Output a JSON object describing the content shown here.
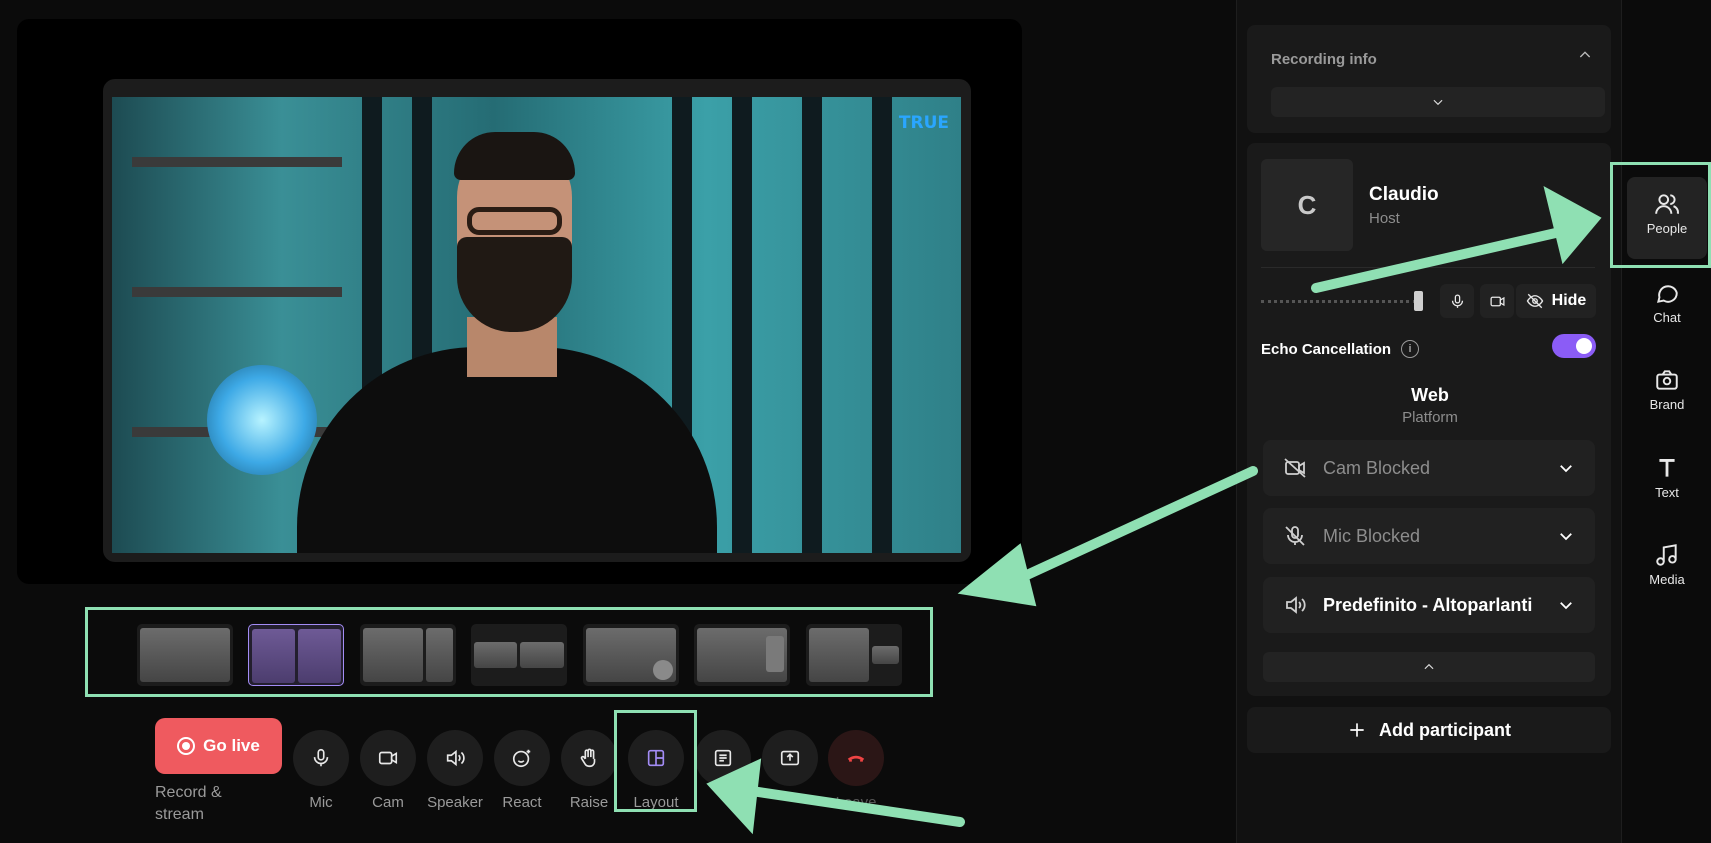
{
  "controls": {
    "go_live": "Go live",
    "go_live_sub": "Record & stream",
    "mic": "Mic",
    "cam": "Cam",
    "speaker": "Speaker",
    "react": "React",
    "raise": "Raise",
    "layout": "Layout",
    "leave": "Leave"
  },
  "video": {
    "overlay_tag": "TRUE"
  },
  "panel": {
    "recording_info": "Recording info",
    "participant": {
      "initial": "C",
      "name": "Claudio",
      "role": "Host"
    },
    "hide": "Hide",
    "echo_cancellation": "Echo Cancellation",
    "platform": "Web",
    "platform_label": "Platform",
    "devices": {
      "cam": "Cam Blocked",
      "mic": "Mic Blocked",
      "speaker": "Predefinito - Altoparlanti"
    },
    "add_participant": "Add participant"
  },
  "rail": {
    "people": "People",
    "chat": "Chat",
    "brand": "Brand",
    "text": "Text",
    "media": "Media"
  },
  "colors": {
    "accent_purple": "#8b5cf6",
    "go_live_red": "#ef5a5f",
    "annotation_green": "#8fe0b3"
  }
}
